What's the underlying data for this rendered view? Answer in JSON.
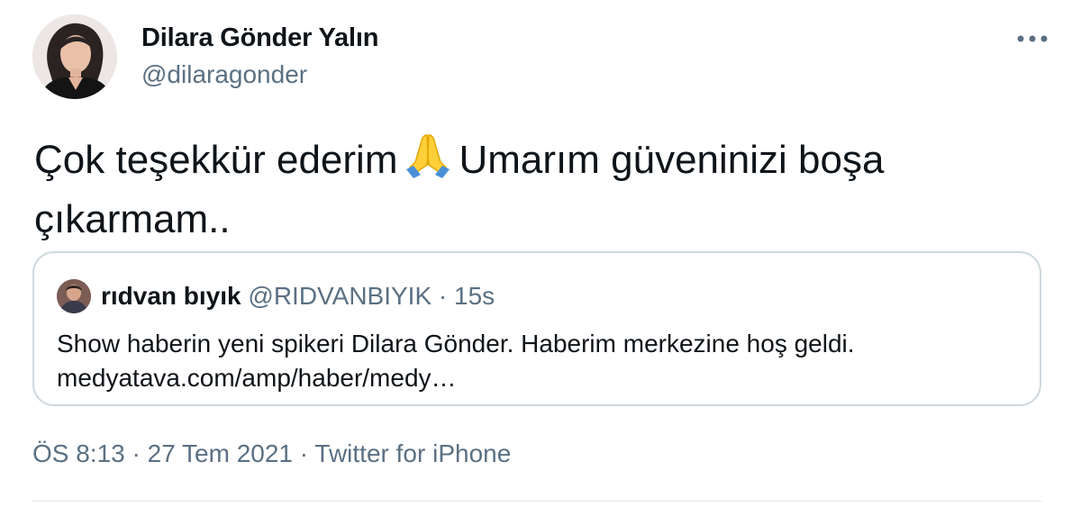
{
  "author": {
    "name": "Dilara Gönder Yalın",
    "handle": "@dilaragonder"
  },
  "more_icon": "more-horizontal-icon",
  "tweet": {
    "text_part1": "Çok teşekkür ederim",
    "emoji": "🙏",
    "text_part2": "Umarım güveninizi boşa çıkarmam.."
  },
  "quoted": {
    "name": "rıdvan bıyık",
    "handle": "@RIDVANBIYIK",
    "separator": "·",
    "time": "15s",
    "text_line1": "Show haberin yeni spikeri Dilara Gönder. Haberim merkezine hoş geldi.",
    "text_line2": "medyatava.com/amp/haber/medy…"
  },
  "meta": {
    "time": "ÖS 8:13",
    "date": "27 Tem 2021",
    "separator": "·",
    "source": "Twitter for iPhone"
  },
  "colors": {
    "text": "#0f1419",
    "secondary": "#5b7083",
    "border": "#cfd9de"
  }
}
